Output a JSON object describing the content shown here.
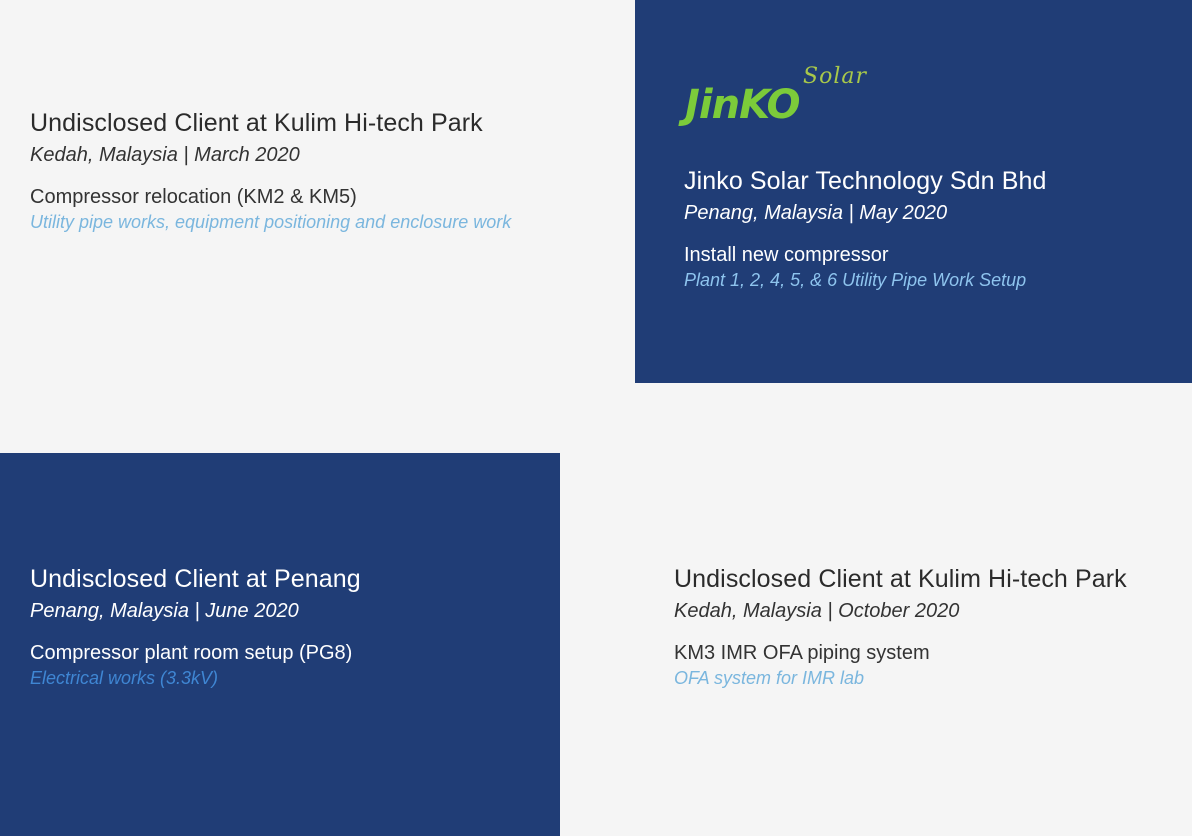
{
  "projects": [
    {
      "client": "Undisclosed Client at Kulim Hi-tech Park",
      "location_date": "Kedah, Malaysia | March 2020",
      "project": "Compressor relocation (KM2 & KM5)",
      "detail": "Utility pipe works, equipment positioning and enclosure work"
    },
    {
      "logo": {
        "main": "JinKO",
        "sub": "Solar"
      },
      "client": "Jinko Solar Technology Sdn Bhd",
      "location_date": "Penang, Malaysia | May 2020",
      "project": "Install new compressor",
      "detail": "Plant 1, 2, 4, 5, & 6 Utility Pipe Work Setup"
    },
    {
      "client": "Undisclosed Client at Penang",
      "location_date": "Penang, Malaysia | June 2020",
      "project": "Compressor plant room setup (PG8)",
      "detail": "Electrical works (3.3kV)"
    },
    {
      "client": "Undisclosed Client at Kulim Hi-tech Park",
      "location_date": "Kedah, Malaysia | October 2020",
      "project": "KM3 IMR OFA piping system",
      "detail": "OFA system for IMR lab"
    }
  ],
  "colors": {
    "page_background": "#f5f5f5",
    "dark_card": "#203d76",
    "accent_light": "#7ab6de",
    "logo_green": "#7ccb3a"
  }
}
